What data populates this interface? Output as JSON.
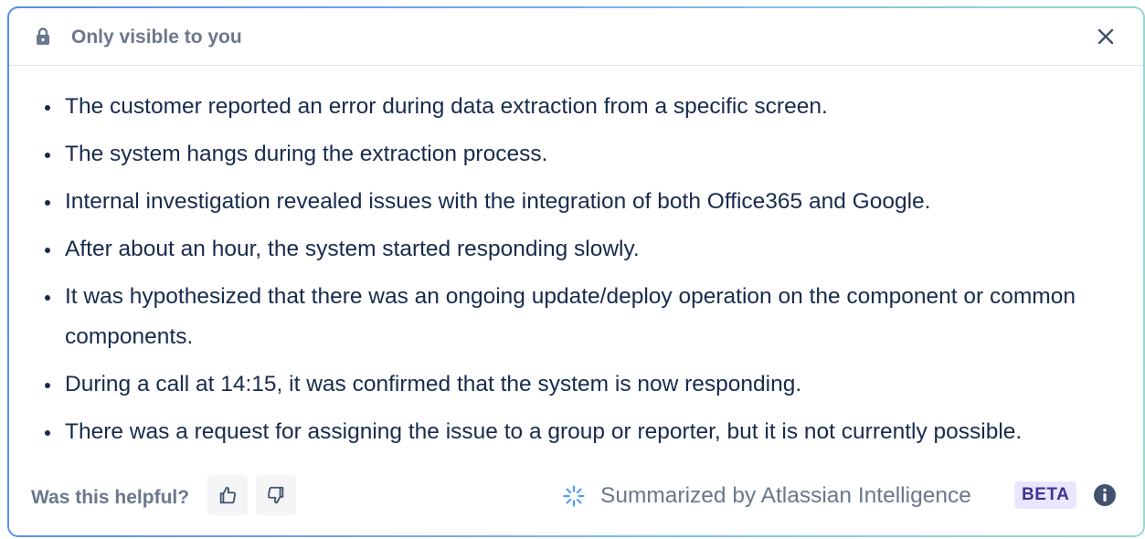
{
  "header": {
    "title": "Only visible to you",
    "lock_icon": "lock-icon",
    "close_icon": "close-icon"
  },
  "summary": {
    "bullets": [
      "The customer reported an error during data extraction from a specific screen.",
      "The system hangs during the extraction process.",
      "Internal investigation revealed issues with the integration of both Office365 and Google.",
      "After about an hour, the system started responding slowly.",
      "It was hypothesized that there was an ongoing update/deploy operation on the component or common components.",
      "During a call at 14:15, it was confirmed that the system is now responding.",
      "There was a request for assigning the issue to a group or reporter, but it is not currently possible."
    ]
  },
  "footer": {
    "helpful_label": "Was this helpful?",
    "thumbs_up_icon": "thumbs-up-icon",
    "thumbs_down_icon": "thumbs-down-icon",
    "attribution": "Summarized by Atlassian Intelligence",
    "badge": "BETA",
    "info_icon": "info-icon"
  },
  "colors": {
    "border_start": "#5b8ae8",
    "border_end": "#9ad8cf",
    "text_primary": "#172b4d",
    "text_subtle": "#6b778c",
    "badge_bg": "#eae6ff",
    "badge_text": "#403294",
    "ai_icon": "#4c9aff"
  }
}
